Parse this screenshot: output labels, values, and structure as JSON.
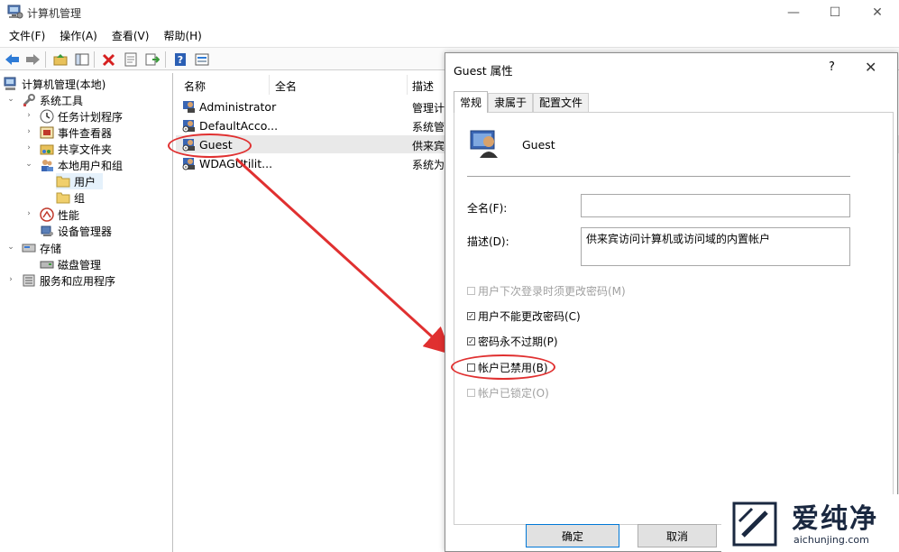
{
  "window": {
    "title": "计算机管理",
    "buttons": {
      "minimize": "—",
      "maximize": "☐",
      "close": "✕"
    }
  },
  "menu": [
    "文件(F)",
    "操作(A)",
    "查看(V)",
    "帮助(H)"
  ],
  "toolbar_icons": [
    "back-arrow-icon",
    "forward-arrow-icon",
    "up-folder-icon",
    "show-hide-tree-icon",
    "delete-icon",
    "properties-icon",
    "export-icon",
    "help-icon",
    "view-icon"
  ],
  "tree": {
    "root": "计算机管理(本地)",
    "items": [
      "系统工具",
      "任务计划程序",
      "事件查看器",
      "共享文件夹",
      "本地用户和组",
      "用户",
      "组",
      "性能",
      "设备管理器",
      "存储",
      "磁盘管理",
      "服务和应用程序"
    ]
  },
  "list": {
    "columns": [
      "名称",
      "全名",
      "描述"
    ],
    "rows": [
      {
        "name": "Administrator",
        "desc": "管理计"
      },
      {
        "name": "DefaultAcco...",
        "desc": "系统管"
      },
      {
        "name": "Guest",
        "desc": "供来宾"
      },
      {
        "name": "WDAGUtilit...",
        "desc": "系统为"
      }
    ]
  },
  "dialog": {
    "title": "Guest 属性",
    "help": "?",
    "close": "✕",
    "tabs": [
      "常规",
      "隶属于",
      "配置文件"
    ],
    "username": "Guest",
    "fullname_label": "全名(F):",
    "fullname_value": "",
    "desc_label": "描述(D):",
    "desc_value": "供来宾访问计算机或访问域的内置帐户",
    "checks": [
      {
        "label": "用户下次登录时须更改密码(M)",
        "checked": false,
        "disabled": true
      },
      {
        "label": "用户不能更改密码(C)",
        "checked": true,
        "disabled": false
      },
      {
        "label": "密码永不过期(P)",
        "checked": true,
        "disabled": false
      },
      {
        "label": "帐户已禁用(B)",
        "checked": false,
        "disabled": false
      },
      {
        "label": "帐户已锁定(O)",
        "checked": false,
        "disabled": true
      }
    ],
    "ok": "确定",
    "cancel": "取消"
  },
  "watermark": {
    "cn": "爱纯净",
    "en": "aichunjing.com"
  },
  "colors": {
    "annotation": "#e03030",
    "accent": "#0078d7"
  }
}
